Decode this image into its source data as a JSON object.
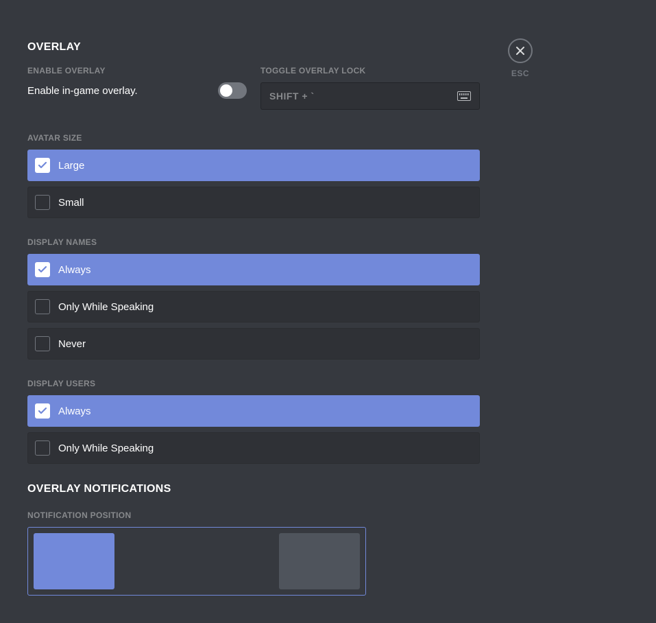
{
  "close": {
    "esc_label": "ESC"
  },
  "header": {
    "title": "OVERLAY"
  },
  "enable_overlay": {
    "label": "ENABLE OVERLAY",
    "text": "Enable in-game overlay.",
    "toggled": false
  },
  "toggle_lock": {
    "label": "TOGGLE OVERLAY LOCK",
    "value": "SHIFT + `"
  },
  "avatar_size": {
    "label": "AVATAR SIZE",
    "options": [
      {
        "label": "Large",
        "selected": true
      },
      {
        "label": "Small",
        "selected": false
      }
    ]
  },
  "display_names": {
    "label": "DISPLAY NAMES",
    "options": [
      {
        "label": "Always",
        "selected": true
      },
      {
        "label": "Only While Speaking",
        "selected": false
      },
      {
        "label": "Never",
        "selected": false
      }
    ]
  },
  "display_users": {
    "label": "DISPLAY USERS",
    "options": [
      {
        "label": "Always",
        "selected": true
      },
      {
        "label": "Only While Speaking",
        "selected": false
      }
    ]
  },
  "notifications": {
    "title": "OVERLAY NOTIFICATIONS",
    "position_label": "NOTIFICATION POSITION",
    "positions": [
      {
        "active": true
      },
      {
        "active": false
      }
    ]
  }
}
